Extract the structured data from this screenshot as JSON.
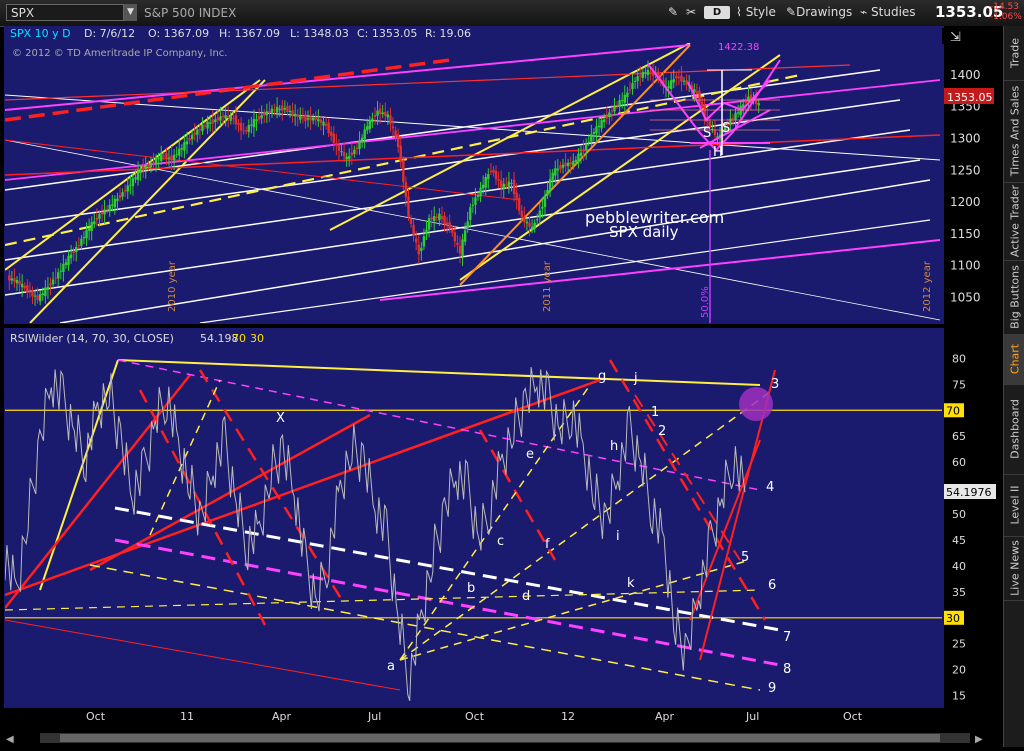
{
  "toolbar": {
    "symbol": "SPX",
    "index_name": "S&P 500 INDEX",
    "last_price": "1353.05",
    "change": "-14.53",
    "change_pct": "-1.06%",
    "style_label": "Style",
    "drawings_label": "Drawings",
    "studies_label": "Studies",
    "d_label": "D"
  },
  "sidebar": {
    "tabs": [
      "Trade",
      "Times And Sales",
      "Active Trader",
      "Big Buttons",
      "Chart",
      "Dashboard",
      "Level II",
      "Live News"
    ],
    "active": "Chart"
  },
  "chart_data": [
    {
      "type": "candlestick",
      "title": "SPX 10 y D",
      "ohlc_header": {
        "date": "D: 7/6/12",
        "open": "O: 1367.09",
        "high": "H: 1367.09",
        "low": "L: 1348.03",
        "close": "C: 1353.05",
        "range": "R: 19.06"
      },
      "copyright": "© 2012 © TD Ameritrade IP Company, Inc.",
      "ylim": [
        1010,
        1450
      ],
      "yticks": [
        1050,
        1100,
        1150,
        1200,
        1250,
        1300,
        1350,
        1400
      ],
      "current_value_label": "1353.05",
      "annotation": [
        "pebblewriter.com",
        "SPX daily"
      ],
      "pattern_labels": [
        "S",
        "S",
        "H"
      ],
      "vertical_labels": [
        "2010 year",
        "2011 year",
        "2012 year",
        "50.0%"
      ],
      "top_labels": [
        "1422.38"
      ],
      "colors": {
        "background": "#1a1a6e",
        "up": "#2fcf2f",
        "down": "#e03030",
        "price_badge": "#c41a1a"
      },
      "closes": [
        1081,
        1075,
        1061,
        1048,
        1067,
        1088,
        1112,
        1134,
        1160,
        1180,
        1193,
        1210,
        1229,
        1251,
        1260,
        1273,
        1268,
        1286,
        1305,
        1319,
        1327,
        1335,
        1331,
        1310,
        1327,
        1339,
        1346,
        1347,
        1336,
        1331,
        1331,
        1320,
        1287,
        1268,
        1286,
        1320,
        1343,
        1335,
        1290,
        1178,
        1118,
        1173,
        1178,
        1160,
        1120,
        1191,
        1220,
        1252,
        1225,
        1230,
        1175,
        1158,
        1195,
        1247,
        1258,
        1262,
        1283,
        1312,
        1330,
        1350,
        1365,
        1393,
        1405,
        1401,
        1378,
        1398,
        1386,
        1370,
        1325,
        1300,
        1325,
        1342,
        1365,
        1353
      ]
    },
    {
      "type": "line",
      "title": "RSIWilder (14, 70, 30, CLOSE)",
      "current": "54.198",
      "levels": [
        "30",
        "70"
      ],
      "current_value_label": "54.1976",
      "ylim": [
        13,
        82
      ],
      "yticks": [
        15,
        20,
        25,
        30,
        35,
        40,
        45,
        50,
        55,
        60,
        65,
        70,
        75,
        80
      ],
      "xticks": [
        "Oct",
        "11",
        "Apr",
        "Jul",
        "Oct",
        "12",
        "Apr",
        "Jul",
        "Oct"
      ],
      "wave_labels": [
        "X",
        "a",
        "b",
        "c",
        "d",
        "e",
        "f",
        "g",
        "h",
        "i",
        "j",
        "k",
        "1",
        "2"
      ],
      "channel_labels": [
        "3",
        "4",
        "5",
        "6",
        "7",
        "8",
        "9"
      ],
      "values": [
        42,
        35,
        50,
        63,
        76,
        72,
        66,
        61,
        70,
        74,
        64,
        54,
        58,
        68,
        73,
        63,
        56,
        48,
        59,
        64,
        52,
        44,
        47,
        58,
        62,
        55,
        40,
        33,
        42,
        55,
        63,
        60,
        52,
        46,
        30,
        18,
        30,
        42,
        50,
        58,
        55,
        45,
        52,
        60,
        67,
        71,
        76,
        72,
        66,
        70,
        62,
        54,
        48,
        58,
        66,
        60,
        51,
        44,
        28,
        23,
        35,
        44,
        53,
        61,
        54.2
      ]
    }
  ]
}
